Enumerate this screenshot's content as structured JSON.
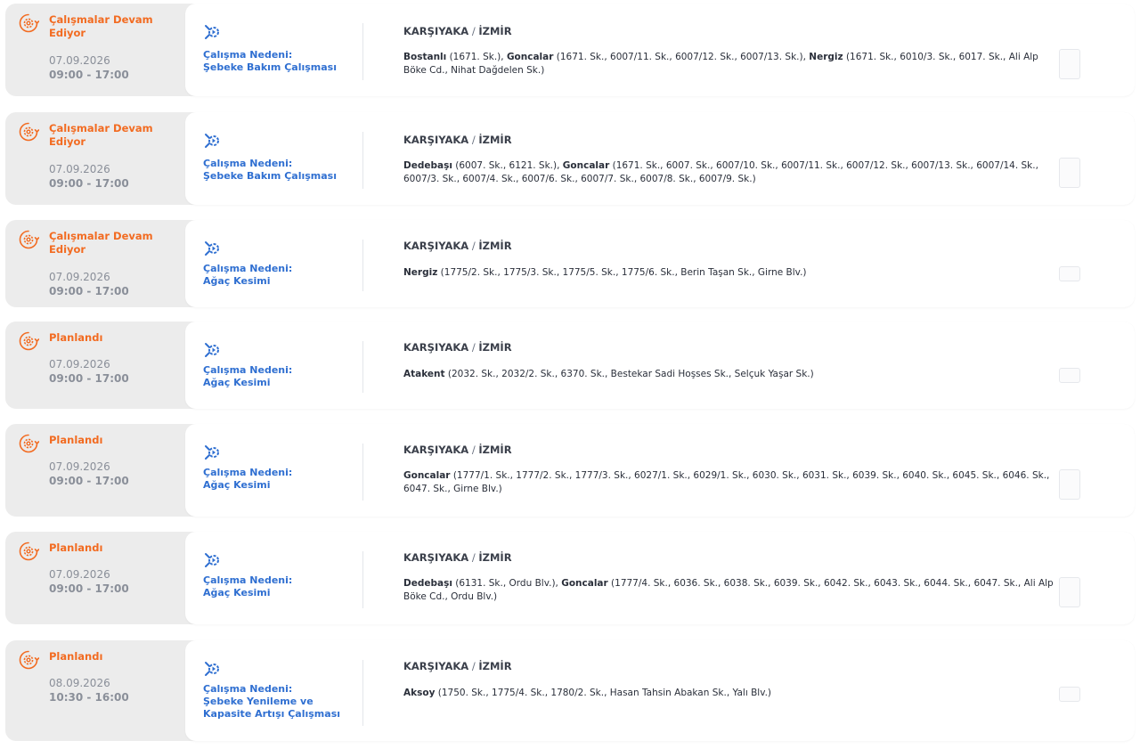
{
  "colors": {
    "status": "#f26b21",
    "reason": "#2f6fd1",
    "muted": "#8a8f99",
    "row_bg": "#ececec",
    "card_bg": "#ffffff"
  },
  "icons": {
    "status": "gear-clock-icon",
    "reason": "wrench-gear-icon"
  },
  "rows": [
    {
      "status": "Çalışmalar Devam Ediyor",
      "date": "07.09.2026",
      "time": "09:00 - 17:00",
      "reason_label": "Çalışma Nedeni:",
      "reason": "Şebeke Bakım Çalışması",
      "district": "KARŞIYAKA",
      "sep": " / ",
      "city": "İZMİR",
      "neighborhoods": [
        {
          "name": "Bostanlı",
          "streets": " (1671. Sk.), "
        },
        {
          "name": "Goncalar",
          "streets": " (1671. Sk., 6007/11. Sk., 6007/12. Sk., 6007/13. Sk.), "
        },
        {
          "name": "Nergiz",
          "streets": " (1671. Sk., 6010/3. Sk., 6017. Sk., Ali Alp Böke Cd., Nihat Dağdelen Sk.)"
        }
      ]
    },
    {
      "status": "Çalışmalar Devam Ediyor",
      "date": "07.09.2026",
      "time": "09:00 - 17:00",
      "reason_label": "Çalışma Nedeni:",
      "reason": "Şebeke Bakım Çalışması",
      "district": "KARŞIYAKA",
      "sep": " / ",
      "city": "İZMİR",
      "neighborhoods": [
        {
          "name": "Dedebaşı",
          "streets": " (6007. Sk., 6121. Sk.), "
        },
        {
          "name": "Goncalar",
          "streets": " (1671. Sk., 6007. Sk., 6007/10. Sk., 6007/11. Sk., 6007/12. Sk., 6007/13. Sk., 6007/14. Sk., 6007/3. Sk., 6007/4. Sk., 6007/6. Sk., 6007/7. Sk., 6007/8. Sk., 6007/9. Sk.)"
        }
      ]
    },
    {
      "status": "Çalışmalar Devam Ediyor",
      "date": "07.09.2026",
      "time": "09:00 - 17:00",
      "reason_label": "Çalışma Nedeni:",
      "reason": "Ağaç Kesimi",
      "district": "KARŞIYAKA",
      "sep": " / ",
      "city": "İZMİR",
      "neighborhoods": [
        {
          "name": "Nergiz",
          "streets": " (1775/2. Sk., 1775/3. Sk., 1775/5. Sk., 1775/6. Sk., Berin Taşan Sk., Girne Blv.)"
        }
      ]
    },
    {
      "status": "Planlandı",
      "date": "07.09.2026",
      "time": "09:00 - 17:00",
      "reason_label": "Çalışma Nedeni:",
      "reason": "Ağaç Kesimi",
      "district": "KARŞIYAKA",
      "sep": " / ",
      "city": "İZMİR",
      "neighborhoods": [
        {
          "name": "Atakent",
          "streets": " (2032. Sk., 2032/2. Sk., 6370. Sk., Bestekar Sadi Hoşses Sk., Selçuk Yaşar Sk.)"
        }
      ]
    },
    {
      "status": "Planlandı",
      "date": "07.09.2026",
      "time": "09:00 - 17:00",
      "reason_label": "Çalışma Nedeni:",
      "reason": "Ağaç Kesimi",
      "district": "KARŞIYAKA",
      "sep": " / ",
      "city": "İZMİR",
      "neighborhoods": [
        {
          "name": "Goncalar",
          "streets": " (1777/1. Sk., 1777/2. Sk., 1777/3. Sk., 6027/1. Sk., 6029/1. Sk., 6030. Sk., 6031. Sk., 6039. Sk., 6040. Sk., 6045. Sk., 6046. Sk., 6047. Sk., Girne Blv.)"
        }
      ]
    },
    {
      "status": "Planlandı",
      "date": "07.09.2026",
      "time": "09:00 - 17:00",
      "reason_label": "Çalışma Nedeni:",
      "reason": "Ağaç Kesimi",
      "district": "KARŞIYAKA",
      "sep": " / ",
      "city": "İZMİR",
      "neighborhoods": [
        {
          "name": "Dedebaşı",
          "streets": " (6131. Sk., Ordu Blv.), "
        },
        {
          "name": "Goncalar",
          "streets": " (1777/4. Sk., 6036. Sk., 6038. Sk., 6039. Sk., 6042. Sk., 6043. Sk., 6044. Sk., 6047. Sk., Ali Alp Böke Cd., Ordu Blv.)"
        }
      ]
    },
    {
      "status": "Planlandı",
      "date": "08.09.2026",
      "time": "10:30 - 16:00",
      "reason_label": "Çalışma Nedeni:",
      "reason": "Şebeke Yenileme ve Kapasite Artışı Çalışması",
      "district": "KARŞIYAKA",
      "sep": " / ",
      "city": "İZMİR",
      "neighborhoods": [
        {
          "name": "Aksoy",
          "streets": " (1750. Sk., 1775/4. Sk., 1780/2. Sk., Hasan Tahsin Abakan Sk., Yalı Blv.)"
        }
      ]
    }
  ]
}
